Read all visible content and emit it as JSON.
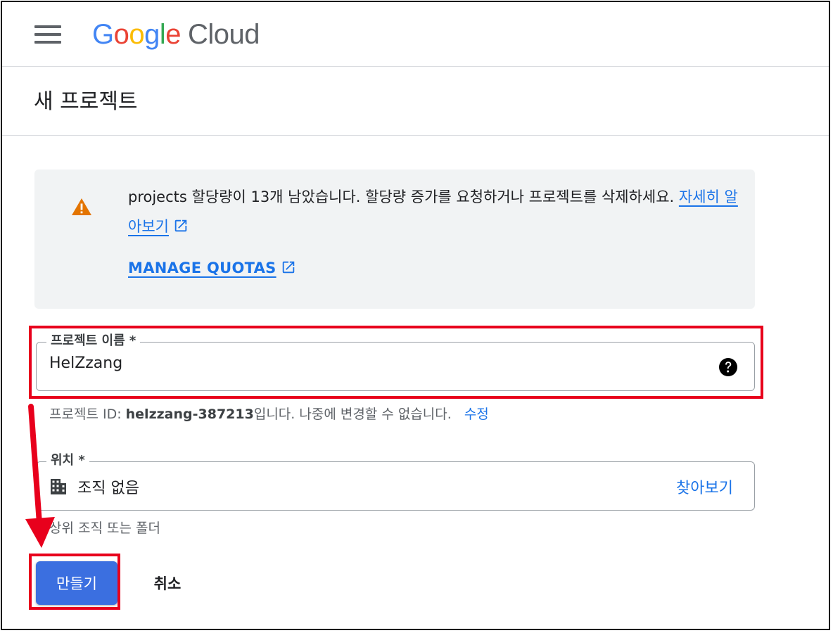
{
  "header": {
    "logo_google": [
      "G",
      "o",
      "o",
      "g",
      "l",
      "e"
    ],
    "logo_cloud": "Cloud",
    "hamburger_icon": "menu-icon"
  },
  "page": {
    "title": "새 프로젝트"
  },
  "notice": {
    "icon": "warning-icon",
    "message": "projects 할당량이 13개 남았습니다. 할당량 증가를 요청하거나 프로젝트를 삭제하세요.",
    "learn_more_label": "자세히 알아보기",
    "manage_quotas_label": "MANAGE QUOTAS"
  },
  "project_name": {
    "label": "프로젝트 이름 *",
    "value": "HelZzang",
    "help_icon": "help-icon"
  },
  "project_id_hint": {
    "prefix": "프로젝트 ID: ",
    "id": "helzzang-387213",
    "suffix": "입니다. 나중에 변경할 수 없습니다.",
    "edit_label": "수정"
  },
  "location": {
    "label": "위치 *",
    "icon": "building-icon",
    "value": "조직 없음",
    "browse_label": "찾아보기",
    "hint": "상위 조직 또는 폴더"
  },
  "buttons": {
    "create_label": "만들기",
    "cancel_label": "취소"
  },
  "annotations": {
    "highlight_color": "#e8001c"
  }
}
